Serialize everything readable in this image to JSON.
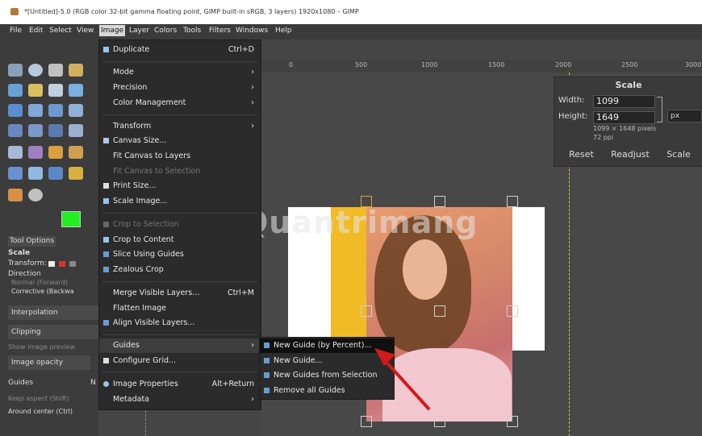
{
  "window": {
    "title": "*[Untitled]-5.0 (RGB color 32-bit gamma floating point, GIMP built-in sRGB, 3 layers) 1920x1080 – GIMP"
  },
  "menubar": [
    "File",
    "Edit",
    "Select",
    "View",
    "Image",
    "Layer",
    "Colors",
    "Tools",
    "Filters",
    "Windows",
    "Help"
  ],
  "image_menu": [
    {
      "label": "Duplicate",
      "shortcut": "Ctrl+D",
      "icon": true
    },
    {
      "label": "Mode",
      "submenu": true
    },
    {
      "label": "Precision",
      "submenu": true
    },
    {
      "label": "Color Management",
      "submenu": true
    },
    {
      "label": "Transform",
      "submenu": true
    },
    {
      "label": "Canvas Size...",
      "icon": true
    },
    {
      "label": "Fit Canvas to Layers"
    },
    {
      "label": "Fit Canvas to Selection",
      "disabled": true
    },
    {
      "label": "Print Size...",
      "icon": true
    },
    {
      "label": "Scale Image...",
      "icon": true
    },
    {
      "label": "Crop to Selection",
      "disabled": true,
      "icon": true
    },
    {
      "label": "Crop to Content",
      "icon": true
    },
    {
      "label": "Slice Using Guides",
      "icon": true
    },
    {
      "label": "Zealous Crop",
      "icon": true
    },
    {
      "label": "Merge Visible Layers...",
      "shortcut": "Ctrl+M"
    },
    {
      "label": "Flatten Image"
    },
    {
      "label": "Align Visible Layers...",
      "icon": true
    },
    {
      "label": "Guides",
      "submenu": true,
      "highlighted": true
    },
    {
      "label": "Configure Grid...",
      "icon": true
    },
    {
      "label": "Image Properties",
      "shortcut": "Alt+Return",
      "icon": true
    },
    {
      "label": "Metadata",
      "submenu": true
    }
  ],
  "guides_submenu": [
    {
      "label": "New Guide (by Percent)...",
      "highlighted": true
    },
    {
      "label": "New Guide..."
    },
    {
      "label": "New Guides from Selection"
    },
    {
      "label": "Remove all Guides"
    }
  ],
  "ruler_ticks": [
    "0",
    "500",
    "1000",
    "1500",
    "2000",
    "2500",
    "3000"
  ],
  "scale_dialog": {
    "title": "Scale",
    "width_label": "Width:",
    "width_value": "1099",
    "height_label": "Height:",
    "height_value": "1649",
    "unit": "px",
    "size_info": "1099 × 1648 pixels",
    "ppi": "72 ppi",
    "reset": "Reset",
    "readjust": "Readjust",
    "scale": "Scale"
  },
  "tool_options": {
    "tab": "Tool Options",
    "tool": "Scale",
    "transform": "Transform:",
    "direction": "Direction",
    "normal": "Normal (Forward)",
    "corrective": "Corrective (Backwa",
    "interpolation": "Interpolation",
    "clipping": "Clipping",
    "show_preview": "Show image preview",
    "image_opacity": "Image opacity",
    "guides": "Guides",
    "guides_value": "N",
    "keep_aspect": "Keep aspect (Shift)",
    "around_center": "Around center (Ctrl)"
  },
  "watermark": "Quantrimang",
  "colors": {
    "accent": "#f1bb26",
    "fg_color": "#22ee22",
    "arrow": "#d11a1a"
  }
}
